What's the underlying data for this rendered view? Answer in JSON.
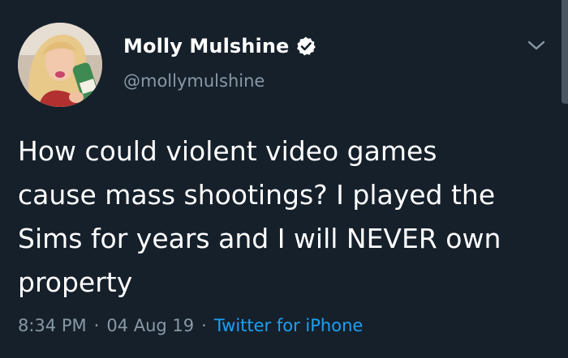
{
  "tweet": {
    "display_name": "Molly Mulshine",
    "handle": "@mollymulshine",
    "text": "How could violent video games\ncause mass shootings? I played the\nSims for years and I will NEVER own\nproperty",
    "time": "8:34 PM",
    "separator": "·",
    "date": "04 Aug 19",
    "source": "Twitter for iPhone",
    "verified": true
  },
  "icons": {
    "verified": "verified-badge-icon",
    "menu": "chevron-down-icon"
  },
  "colors": {
    "background": "#15202b",
    "primary_text": "#ffffff",
    "secondary_text": "#8899a6",
    "link": "#1da1f2"
  }
}
